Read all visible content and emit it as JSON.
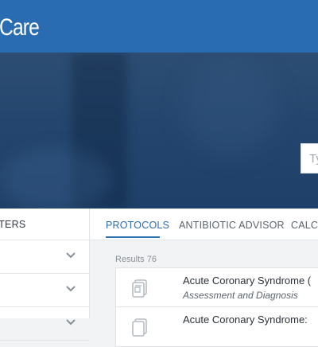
{
  "header": {
    "brand": "Care"
  },
  "search": {
    "placeholder": "Ty"
  },
  "filters": {
    "title": "LTERS",
    "rows": [
      {
        "icon": "chevron-down-icon"
      },
      {
        "icon": "chevron-down-icon"
      },
      {
        "icon": "chevron-down-icon"
      }
    ]
  },
  "tabs": [
    {
      "label": "PROTOCOLS",
      "active": true
    },
    {
      "label": "ANTIBIOTIC ADVISOR",
      "active": false
    },
    {
      "label": "CALCU",
      "active": false
    }
  ],
  "results": {
    "label": "Results 76"
  },
  "protocols": [
    {
      "title": "Acute Coronary Syndrome (",
      "subtitle": "Assessment and Diagnosis",
      "icon": "document-icon"
    },
    {
      "title": "Acute Coronary Syndrome:",
      "subtitle": "",
      "icon": "document-icon"
    }
  ],
  "colors": {
    "brand": "#2a6cb1",
    "hero": "#24466e",
    "background": "#f2f3f5"
  }
}
